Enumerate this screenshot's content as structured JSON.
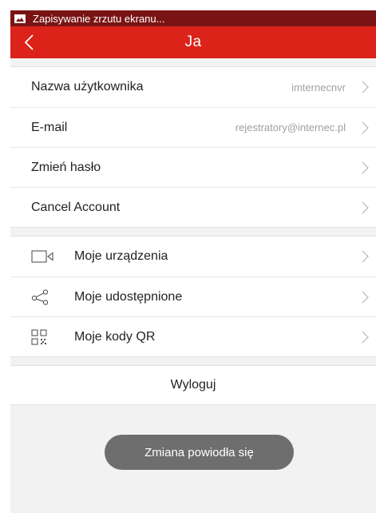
{
  "statusbar": {
    "notification_text": "Zapisywanie zrzutu ekranu..."
  },
  "appbar": {
    "title": "Ja"
  },
  "account": {
    "rows": [
      {
        "label": "Nazwa użytkownika",
        "value": "imternecnvr"
      },
      {
        "label": "E-mail",
        "value": "rejestratory@internec.pl"
      },
      {
        "label": "Zmień hasło"
      },
      {
        "label": "Cancel Account"
      }
    ]
  },
  "devices": {
    "rows": [
      {
        "icon": "camera-icon",
        "label": "Moje urządzenia"
      },
      {
        "icon": "share-icon",
        "label": "Moje udostępnione"
      },
      {
        "icon": "qr-code-icon",
        "label": "Moje kody QR"
      }
    ]
  },
  "logout": {
    "label": "Wyloguj"
  },
  "toast": {
    "text": "Zmiana powiodła się"
  },
  "colors": {
    "accent": "#dc2319",
    "statusbar": "#7a1414",
    "background": "#f2f2f2"
  }
}
